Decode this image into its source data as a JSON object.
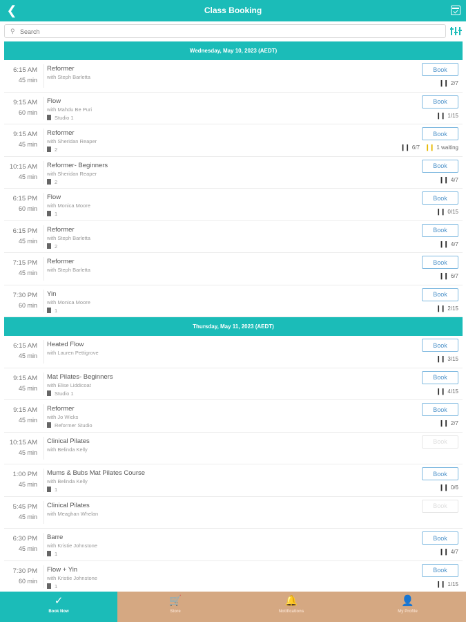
{
  "header": {
    "title": "Class Booking",
    "back_icon": "chevron-left-icon",
    "calendar_icon": "calendar-check-icon"
  },
  "search": {
    "placeholder": "Search",
    "value": ""
  },
  "days": [
    {
      "date": "Wednesday, May 10, 2023 (AEDT)",
      "classes": [
        {
          "time": "6:15 AM",
          "duration": "45 min",
          "name": "Reformer",
          "instructor": "with Steph Barletta",
          "location": "",
          "book": "Book",
          "enabled": true,
          "capacity": "2/7",
          "waiting": ""
        },
        {
          "time": "9:15 AM",
          "duration": "60 min",
          "name": "Flow",
          "instructor": "with Mahdu Be Puri",
          "location": "Studio 1",
          "book": "Book",
          "enabled": true,
          "capacity": "1/15",
          "waiting": ""
        },
        {
          "time": "9:15 AM",
          "duration": "45 min",
          "name": "Reformer",
          "instructor": "with Sheridan Reaper",
          "location": "2",
          "book": "Book",
          "enabled": true,
          "capacity": "6/7",
          "waiting": "1 waiting"
        },
        {
          "time": "10:15 AM",
          "duration": "45 min",
          "name": "Reformer- Beginners",
          "instructor": "with Sheridan Reaper",
          "location": "2",
          "book": "Book",
          "enabled": true,
          "capacity": "4/7",
          "waiting": ""
        },
        {
          "time": "6:15 PM",
          "duration": "60 min",
          "name": "Flow",
          "instructor": "with Monica Moore",
          "location": "1",
          "book": "Book",
          "enabled": true,
          "capacity": "0/15",
          "waiting": ""
        },
        {
          "time": "6:15 PM",
          "duration": "45 min",
          "name": "Reformer",
          "instructor": "with Steph Barletta",
          "location": "2",
          "book": "Book",
          "enabled": true,
          "capacity": "4/7",
          "waiting": ""
        },
        {
          "time": "7:15 PM",
          "duration": "45 min",
          "name": "Reformer",
          "instructor": "with Steph Barletta",
          "location": "",
          "book": "Book",
          "enabled": true,
          "capacity": "6/7",
          "waiting": ""
        },
        {
          "time": "7:30 PM",
          "duration": "60 min",
          "name": "Yin",
          "instructor": "with Monica Moore",
          "location": "1",
          "book": "Book",
          "enabled": true,
          "capacity": "2/15",
          "waiting": ""
        }
      ]
    },
    {
      "date": "Thursday, May 11, 2023 (AEDT)",
      "classes": [
        {
          "time": "6:15 AM",
          "duration": "45 min",
          "name": "Heated Flow",
          "instructor": "with Lauren Pettigrove",
          "location": "",
          "book": "Book",
          "enabled": true,
          "capacity": "3/15",
          "waiting": ""
        },
        {
          "time": "9:15 AM",
          "duration": "45 min",
          "name": "Mat Pilates- Beginners",
          "instructor": "with Elise Liddicoat",
          "location": "Studio 1",
          "book": "Book",
          "enabled": true,
          "capacity": "4/15",
          "waiting": ""
        },
        {
          "time": "9:15 AM",
          "duration": "45 min",
          "name": "Reformer",
          "instructor": "with Jo Wicks",
          "location": "Reformer Studio",
          "book": "Book",
          "enabled": true,
          "capacity": "2/7",
          "waiting": ""
        },
        {
          "time": "10:15 AM",
          "duration": "45 min",
          "name": "Clinical Pilates",
          "instructor": "with Belinda Kelly",
          "location": "",
          "book": "Book",
          "enabled": false,
          "capacity": "",
          "waiting": ""
        },
        {
          "time": "1:00 PM",
          "duration": "45 min",
          "name": "Mums & Bubs Mat Pilates Course",
          "instructor": "with Belinda Kelly",
          "location": "1",
          "book": "Book",
          "enabled": true,
          "capacity": "0/6",
          "waiting": ""
        },
        {
          "time": "5:45 PM",
          "duration": "45 min",
          "name": "Clinical Pilates",
          "instructor": "with Meaghan Whelan",
          "location": "",
          "book": "Book",
          "enabled": false,
          "capacity": "",
          "waiting": ""
        },
        {
          "time": "6:30 PM",
          "duration": "45 min",
          "name": "Barre",
          "instructor": "with Kristie Johnstone",
          "location": "1",
          "book": "Book",
          "enabled": true,
          "capacity": "4/7",
          "waiting": ""
        },
        {
          "time": "7:30 PM",
          "duration": "60 min",
          "name": "Flow + Yin",
          "instructor": "with Kristie Johnstone",
          "location": "1",
          "book": "Book",
          "enabled": true,
          "capacity": "1/15",
          "waiting": ""
        }
      ]
    }
  ],
  "tabs": [
    {
      "label": "Book Now",
      "icon": "check-circle-icon",
      "glyph": "✓",
      "active": true
    },
    {
      "label": "Store",
      "icon": "cart-icon",
      "glyph": "🛒",
      "active": false
    },
    {
      "label": "Notifications",
      "icon": "bell-icon",
      "glyph": "🔔",
      "active": false
    },
    {
      "label": "My Profile",
      "icon": "person-icon",
      "glyph": "👤",
      "active": false
    }
  ],
  "colors": {
    "accent": "#1bbcb8",
    "tabbar": "#d5a882",
    "button_border": "#7fb9e0",
    "button_text": "#4a90c8",
    "waiting": "#e6b800"
  }
}
